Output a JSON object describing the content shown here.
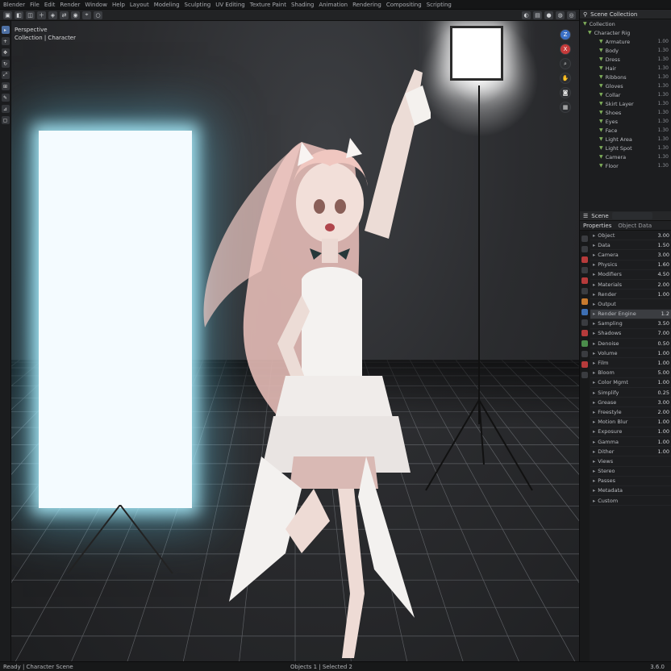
{
  "menu": [
    "Blender",
    "File",
    "Edit",
    "Render",
    "Window",
    "Help",
    "Layout",
    "Modeling",
    "Sculpting",
    "UV Editing",
    "Texture Paint",
    "Shading",
    "Animation",
    "Rendering",
    "Compositing",
    "Scripting"
  ],
  "viewport": {
    "info_line1": "Perspective",
    "info_line2": "Collection | Character"
  },
  "outliner": {
    "title": "Scene Collection",
    "rows": [
      {
        "name": "Collection",
        "val": ""
      },
      {
        "name": "Character Rig",
        "val": ""
      },
      {
        "name": "Armature",
        "val": "1.00"
      },
      {
        "name": "Body",
        "val": "1.30"
      },
      {
        "name": "Dress",
        "val": "1.30"
      },
      {
        "name": "Hair",
        "val": "1.30"
      },
      {
        "name": "Ribbons",
        "val": "1.30"
      },
      {
        "name": "Gloves",
        "val": "1.30"
      },
      {
        "name": "Collar",
        "val": "1.30"
      },
      {
        "name": "Skirt Layer",
        "val": "1.30"
      },
      {
        "name": "Shoes",
        "val": "1.30"
      },
      {
        "name": "Eyes",
        "val": "1.30"
      },
      {
        "name": "Face",
        "val": "1.30"
      },
      {
        "name": "Light Area",
        "val": "1.30"
      },
      {
        "name": "Light Spot",
        "val": "1.30"
      },
      {
        "name": "Camera",
        "val": "1.30"
      },
      {
        "name": "Floor",
        "val": "1.30"
      }
    ]
  },
  "properties": {
    "tab_label": "Scene",
    "header": "Properties",
    "section": "Object Data",
    "rows": [
      {
        "name": "Object",
        "val": "3.00",
        "sel": false
      },
      {
        "name": "Data",
        "val": "1.50",
        "sel": false
      },
      {
        "name": "Camera",
        "val": "3.00",
        "sel": false
      },
      {
        "name": "Physics",
        "val": "1.60",
        "sel": false
      },
      {
        "name": "Modifiers",
        "val": "4.50",
        "sel": false
      },
      {
        "name": "Materials",
        "val": "2.00",
        "sel": false
      },
      {
        "name": "Render",
        "val": "1.00",
        "sel": false
      },
      {
        "name": "Output",
        "val": "",
        "sel": false
      },
      {
        "name": "Render Engine",
        "val": "1.2",
        "sel": true
      },
      {
        "name": "Sampling",
        "val": "3.50",
        "sel": false
      },
      {
        "name": "Shadows",
        "val": "7.00",
        "sel": false
      },
      {
        "name": "Denoise",
        "val": "0.50",
        "sel": false
      },
      {
        "name": "Volume",
        "val": "1.00",
        "sel": false
      },
      {
        "name": "Film",
        "val": "1.00",
        "sel": false
      },
      {
        "name": "Bloom",
        "val": "5.00",
        "sel": false
      },
      {
        "name": "Color Mgmt",
        "val": "1.00",
        "sel": false
      },
      {
        "name": "Simplify",
        "val": "0.25",
        "sel": false
      },
      {
        "name": "Grease",
        "val": "3.00",
        "sel": false
      },
      {
        "name": "Freestyle",
        "val": "2.00",
        "sel": false
      },
      {
        "name": "Motion Blur",
        "val": "1.00",
        "sel": false
      },
      {
        "name": "Exposure",
        "val": "1.00",
        "sel": false
      },
      {
        "name": "Gamma",
        "val": "1.00",
        "sel": false
      },
      {
        "name": "Dither",
        "val": "1.00",
        "sel": false
      },
      {
        "name": "Views",
        "val": "",
        "sel": false
      },
      {
        "name": "Stereo",
        "val": "",
        "sel": false
      },
      {
        "name": "Passes",
        "val": "",
        "sel": false
      },
      {
        "name": "Metadata",
        "val": "",
        "sel": false
      },
      {
        "name": "Custom",
        "val": "",
        "sel": false
      }
    ]
  },
  "status": {
    "left": "Ready | Character Scene",
    "middle": "Objects 1 | Selected 2",
    "right": "3.6.0"
  }
}
